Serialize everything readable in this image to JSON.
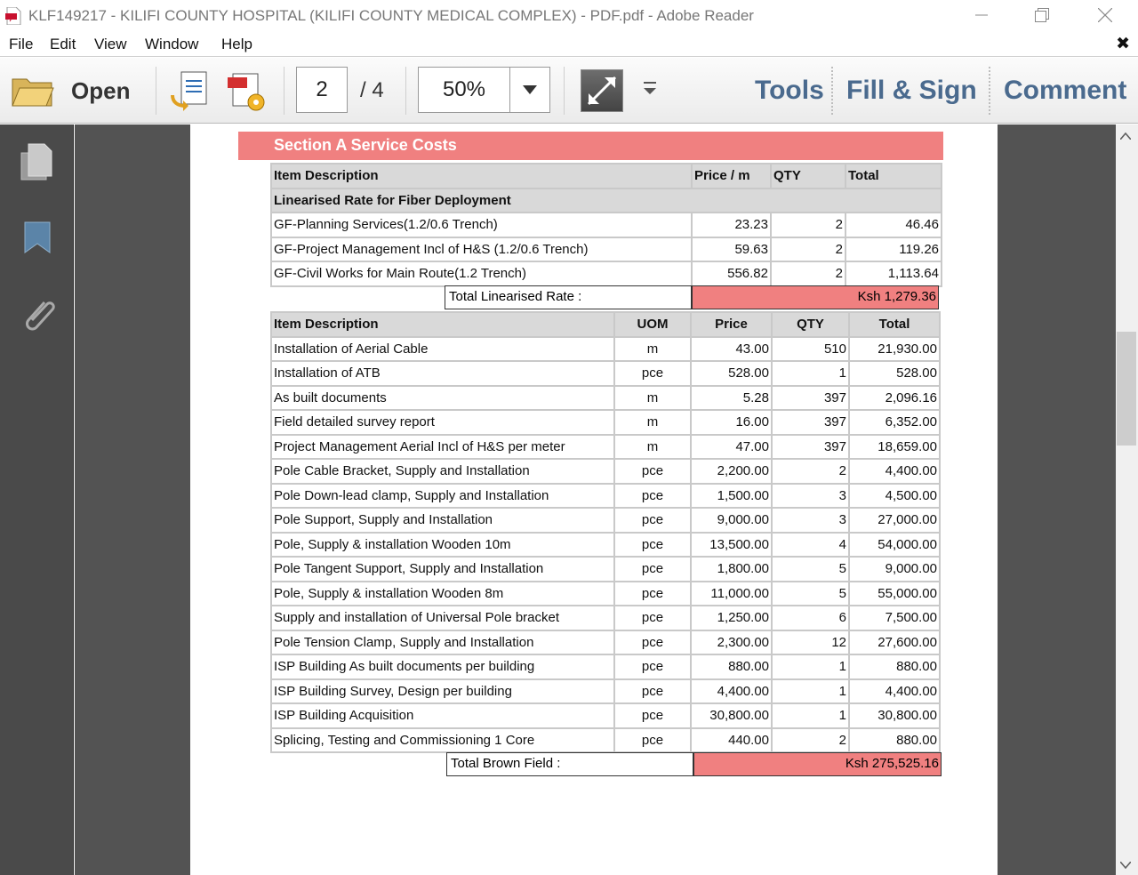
{
  "window": {
    "title": "KLF149217 - KILIFI COUNTY HOSPITAL (KILIFI COUNTY MEDICAL COMPLEX) - PDF.pdf - Adobe Reader"
  },
  "menu": {
    "file": "File",
    "edit": "Edit",
    "view": "View",
    "window": "Window",
    "help": "Help",
    "close_glyph": "✖"
  },
  "toolbar": {
    "open_label": "Open",
    "page_current": "2",
    "page_total": "/ 4",
    "zoom_value": "50%",
    "tools_label": "Tools",
    "fill_sign_label": "Fill & Sign",
    "comment_label": "Comment"
  },
  "document": {
    "section_title": "Section A Service Costs",
    "linearised": {
      "headers": {
        "description": "Item Description",
        "price": "Price / m",
        "qty": "QTY",
        "total": "Total"
      },
      "subheader": "Linearised Rate for Fiber Deployment",
      "rows": [
        {
          "description": "GF-Planning Services(1.2/0.6 Trench)",
          "price": "23.23",
          "qty": "2",
          "total": "46.46"
        },
        {
          "description": "GF-Project Management Incl of H&S (1.2/0.6 Trench)",
          "price": "59.63",
          "qty": "2",
          "total": "119.26"
        },
        {
          "description": "GF-Civil Works for Main Route(1.2 Trench)",
          "price": "556.82",
          "qty": "2",
          "total": "1,113.64"
        }
      ],
      "total_label": "Total Linearised Rate :",
      "total_value": "Ksh 1,279.36"
    },
    "brownfield": {
      "headers": {
        "description": "Item Description",
        "uom": "UOM",
        "price": "Price",
        "qty": "QTY",
        "total": "Total"
      },
      "rows": [
        {
          "description": "Installation of Aerial Cable",
          "uom": "m",
          "price": "43.00",
          "qty": "510",
          "total": "21,930.00"
        },
        {
          "description": "Installation of ATB",
          "uom": "pce",
          "price": "528.00",
          "qty": "1",
          "total": "528.00"
        },
        {
          "description": " As built documents",
          "uom": "m",
          "price": "5.28",
          "qty": "397",
          "total": "2,096.16"
        },
        {
          "description": " Field detailed survey report",
          "uom": "m",
          "price": "16.00",
          "qty": "397",
          "total": "6,352.00"
        },
        {
          "description": "Project Management Aerial Incl of H&S per meter",
          "uom": "m",
          "price": "47.00",
          "qty": "397",
          "total": "18,659.00"
        },
        {
          "description": "Pole Cable Bracket, Supply and Installation",
          "uom": "pce",
          "price": "2,200.00",
          "qty": "2",
          "total": "4,400.00"
        },
        {
          "description": "Pole Down-lead clamp, Supply and Installation",
          "uom": "pce",
          "price": "1,500.00",
          "qty": "3",
          "total": "4,500.00"
        },
        {
          "description": "Pole Support, Supply and Installation",
          "uom": "pce",
          "price": "9,000.00",
          "qty": "3",
          "total": "27,000.00"
        },
        {
          "description": "Pole, Supply & installation Wooden 10m",
          "uom": "pce",
          "price": "13,500.00",
          "qty": "4",
          "total": "54,000.00"
        },
        {
          "description": "Pole Tangent Support, Supply and Installation",
          "uom": "pce",
          "price": "1,800.00",
          "qty": "5",
          "total": "9,000.00"
        },
        {
          "description": "Pole, Supply & installation Wooden 8m",
          "uom": "pce",
          "price": "11,000.00",
          "qty": "5",
          "total": "55,000.00"
        },
        {
          "description": "Supply and installation of Universal Pole bracket",
          "uom": "pce",
          "price": "1,250.00",
          "qty": "6",
          "total": "7,500.00"
        },
        {
          "description": "Pole Tension Clamp, Supply and Installation",
          "uom": "pce",
          "price": "2,300.00",
          "qty": "12",
          "total": "27,600.00"
        },
        {
          "description": "ISP Building As built documents per building",
          "uom": "pce",
          "price": "880.00",
          "qty": "1",
          "total": "880.00"
        },
        {
          "description": "ISP Building Survey, Design per building",
          "uom": "pce",
          "price": "4,400.00",
          "qty": "1",
          "total": "4,400.00"
        },
        {
          "description": "ISP Building Acquisition",
          "uom": "pce",
          "price": "30,800.00",
          "qty": "1",
          "total": "30,800.00"
        },
        {
          "description": "Splicing, Testing and Commissioning  1 Core",
          "uom": "pce",
          "price": "440.00",
          "qty": "2",
          "total": "880.00"
        }
      ],
      "total_label": "Total Brown Field :",
      "total_value": "Ksh 275,525.16"
    }
  },
  "colors": {
    "accent_salmon": "#f08080",
    "tool_link_blue": "#4a6a8e",
    "panel_dark": "#4a4a4a"
  },
  "icons": {
    "app": "pdf-file-icon",
    "open": "folder-icon",
    "left_panel": [
      "pages-icon",
      "bookmark-icon",
      "paperclip-icon"
    ]
  }
}
